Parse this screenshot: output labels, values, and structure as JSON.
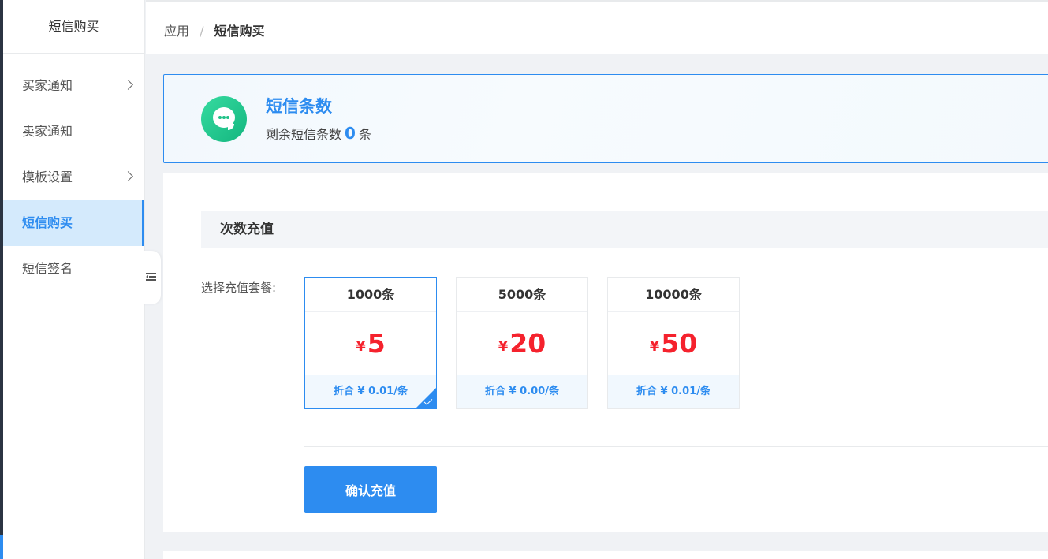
{
  "sidebar": {
    "title": "短信购买",
    "items": [
      {
        "label": "买家通知",
        "has_arrow": true
      },
      {
        "label": "卖家通知",
        "has_arrow": false
      },
      {
        "label": "模板设置",
        "has_arrow": true
      },
      {
        "label": "短信购买",
        "active": true
      },
      {
        "label": "短信签名",
        "has_arrow": false
      }
    ]
  },
  "breadcrumb": {
    "root": "应用",
    "separator": "/",
    "current": "短信购买"
  },
  "sms_card": {
    "icon": "chat-bubble-icon",
    "title": "短信条数",
    "remain_prefix": "剩余短信条数",
    "remain_count": "0",
    "remain_suffix": "条"
  },
  "recharge": {
    "section_title": "次数充值",
    "select_label": "选择充值套餐:",
    "packages": [
      {
        "name": "1000条",
        "currency": "¥",
        "price": "5",
        "unit_price": "折合 ¥ 0.01/条",
        "selected": true
      },
      {
        "name": "5000条",
        "currency": "¥",
        "price": "20",
        "unit_price": "折合 ¥ 0.00/条",
        "selected": false
      },
      {
        "name": "10000条",
        "currency": "¥",
        "price": "50",
        "unit_price": "折合 ¥ 0.01/条",
        "selected": false
      }
    ],
    "confirm_label": "确认充值"
  },
  "colors": {
    "accent": "#2d8cf0",
    "price": "#f5222d",
    "icon_green": "#1fc287"
  }
}
